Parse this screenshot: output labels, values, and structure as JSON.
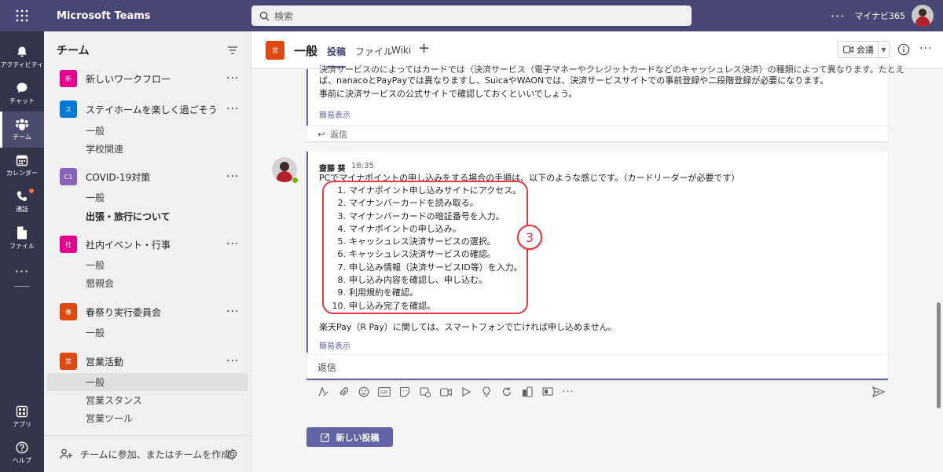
{
  "app": {
    "title": "Microsoft Teams",
    "tenant": "マイナビ365"
  },
  "search": {
    "placeholder": "検索"
  },
  "rail": [
    {
      "label": "アクティビティ",
      "icon": "bell-icon"
    },
    {
      "label": "チャット",
      "icon": "chat-icon"
    },
    {
      "label": "チーム",
      "icon": "teams-icon",
      "active": true
    },
    {
      "label": "カレンダー",
      "icon": "calendar-icon"
    },
    {
      "label": "通話",
      "icon": "phone-icon"
    },
    {
      "label": "ファイル",
      "icon": "file-icon"
    },
    {
      "label": "アプリ",
      "icon": "apps-icon"
    },
    {
      "label": "ヘルプ",
      "icon": "help-icon"
    }
  ],
  "teams_panel": {
    "title": "チーム",
    "teams": [
      {
        "name": "新しいワークフロー",
        "abbr": "新",
        "color": "#e3008c",
        "channels": []
      },
      {
        "name": "ステイホームを楽しく過ごそう",
        "abbr": "ス",
        "color": "#0078d4",
        "channels": [
          "一般",
          "学校関連"
        ]
      },
      {
        "name": "COVID-19対策",
        "abbr": "C1",
        "color": "#8764b8",
        "channels": [
          "一般",
          "出張・旅行について"
        ]
      },
      {
        "name": "社内イベント・行事",
        "abbr": "社",
        "color": "#e3008c",
        "channels": [
          "一般",
          "懇親会"
        ]
      },
      {
        "name": "春祭り実行委員会",
        "abbr": "春",
        "color": "#dc4a12",
        "channels": [
          "一般"
        ]
      },
      {
        "name": "営業活動",
        "abbr": "営",
        "color": "#dc4a12",
        "channels": [
          "一般",
          "営業スタンス",
          "営業ツール"
        ]
      }
    ],
    "footer": "チームに参加、またはチームを作成"
  },
  "channel": {
    "avatar": "営",
    "name": "一般",
    "tabs": [
      "投稿",
      "ファイル",
      "Wiki"
    ],
    "meet_label": "会議"
  },
  "messages": {
    "first": {
      "partial_line": "決済サービスのによってはカードでは〈決済サービス（電子マネーやクレジットカードなどのキャッシュレス決済）の種類によって異なります。たとえ",
      "lines": [
        "ば、nanacoとPayPayでは異なりますし、SuicaやWAONでは、決済サービスサイトでの事前登録や二段階登録が必要になります。",
        "事前に決済サービスの公式サイトで確認しておくといいでしょう。"
      ],
      "collapse": "簡易表示",
      "reply": "返信"
    },
    "second": {
      "author": "齋藤 葵",
      "time": "18:35",
      "intro": "PCでマイナポイントの申し込みをする場合の手順は、以下のような感じです。（カードリーダーが必要です）",
      "steps": [
        {
          "num": "1.",
          "text": "マイナポイント申し込みサイトにアクセス。"
        },
        {
          "num": "2.",
          "text": "マイナンバーカードを読み取る。"
        },
        {
          "num": "3.",
          "text": "マイナンバーカードの暗証番号を入力。"
        },
        {
          "num": "4.",
          "text": "マイナポイントの申し込み。"
        },
        {
          "num": "5.",
          "text": "キャッシュレス決済サービスの選択。"
        },
        {
          "num": "6.",
          "text": "キャッシュレス決済サービスの確認。"
        },
        {
          "num": "7.",
          "text": "申し込み情報（決済サービスID等）を入力。"
        },
        {
          "num": "8.",
          "text": "申し込み内容を確認し、申し込む。"
        },
        {
          "num": "9.",
          "text": "利用規約を確認。"
        },
        {
          "num": "10.",
          "text": "申し込み完了を確認。"
        }
      ],
      "outro": "楽天Pay（R Pay）に関しては、スマートフォンで亡ければ申し込めません。",
      "collapse": "簡易表示",
      "annotation": "3",
      "reply_placeholder": "返信"
    }
  },
  "new_post": {
    "label": "新しい投稿"
  },
  "colors": {
    "brand": "#6264a7",
    "topbar": "#464775",
    "rail": "#33344a",
    "annotation": "#e63946"
  }
}
